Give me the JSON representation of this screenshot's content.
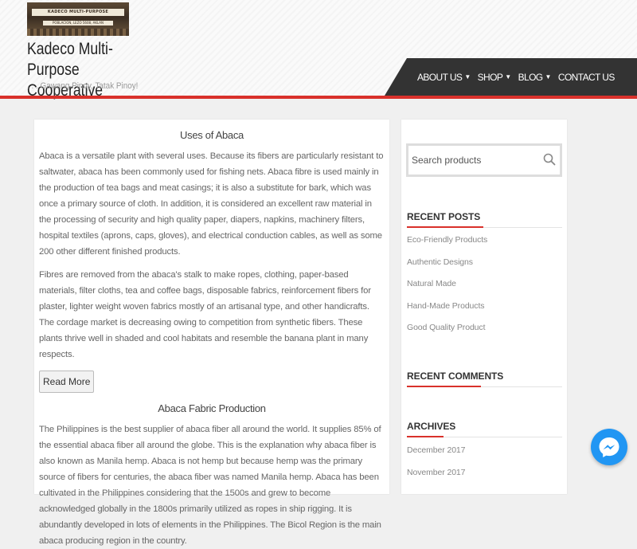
{
  "site": {
    "logo_text": "KADECO MULTI-PURPOSE COOPERATIVE",
    "logo_subtext": "POBLACION, LEZO 5608, AKLAN",
    "title": "Kadeco Multi-Purpose Cooperative",
    "tagline": ". . . Gawang Pinoy, Tatak Pinoy!"
  },
  "nav": {
    "items": [
      {
        "label": "ABOUT US",
        "dropdown": true
      },
      {
        "label": "SHOP",
        "dropdown": true
      },
      {
        "label": "BLOG",
        "dropdown": true
      },
      {
        "label": "CONTACT US",
        "dropdown": false
      }
    ],
    "caret": "▼"
  },
  "main": {
    "sections": [
      {
        "title": "Uses of Abaca",
        "paragraphs": [
          "Abaca is a versatile plant with several uses. Because its fibers are particularly resistant to saltwater, abaca has been commonly used for fishing nets. Abaca fibre is used mainly in the production of tea bags and meat casings; it is also a substitute for bark, which was once a primary source of cloth. In addition, it is considered an excellent raw material in the processing of security and high quality paper, diapers, napkins, machinery filters, hospital textiles (aprons, caps, gloves), and electrical conduction cables, as well as some 200 other different finished products.",
          "Fibres are removed from the abaca's stalk to make ropes, clothing, paper-based materials, filter cloths, tea and coffee bags, disposable fabrics, reinforcement fibers for plaster, lighter weight woven fabrics mostly of an artisanal type, and other handicrafts. The cordage market is decreasing owing to competition from synthetic fibers. These plants thrive well in shaded and cool habitats and resemble the banana plant in many respects."
        ],
        "read_more": "Read More"
      },
      {
        "title": "Abaca Fabric Production",
        "paragraphs": [
          "The Philippines is the best supplier of abaca fiber all around the world. It supplies 85% of the essential abaca fiber all around the globe. This is the explanation why abaca fiber is also known as Manila hemp. Abaca is not hemp but because hemp was the primary source of fibers for centuries, the abaca fiber was named Manila hemp. Abaca has been cultivated in the Philippines considering that the 1500s and grew to become acknowledged globally in the 1800s primarily utilized as ropes in ship rigging. It is abundantly developed in lots of elements in the Philippines. The Bicol Region is the main abaca producing region in the country."
        ]
      }
    ]
  },
  "sidebar": {
    "search": {
      "placeholder": "Search products",
      "icon": "search-icon"
    },
    "recent_posts": {
      "title": "RECENT POSTS",
      "items": [
        "Eco-Friendly Products",
        "Authentic Designs",
        "Natural Made",
        "Hand-Made Products",
        "Good Quality Product"
      ]
    },
    "recent_comments": {
      "title": "RECENT COMMENTS"
    },
    "archives": {
      "title": "ARCHIVES",
      "items": [
        "December 2017",
        "November 2017"
      ]
    }
  },
  "colors": {
    "accent": "#d9312b",
    "nav_background": "#333333",
    "messenger": "#2196f3"
  },
  "floating": {
    "icon": "messenger-icon"
  }
}
